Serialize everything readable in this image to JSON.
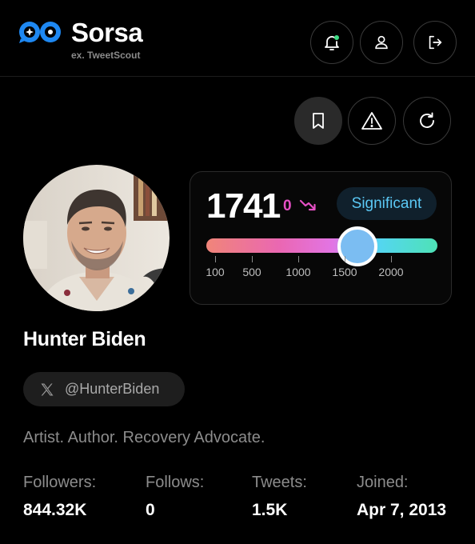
{
  "header": {
    "brand": "Sorsa",
    "brand_sub": "ex. TweetScout",
    "icons": [
      "bell-icon",
      "user-icon",
      "logout-icon"
    ]
  },
  "actions": {
    "icons": [
      "bookmark-icon",
      "warning-icon",
      "refresh-icon"
    ]
  },
  "score": {
    "value": "1741",
    "delta": "0",
    "badge": "Significant",
    "ticks": [
      "100",
      "500",
      "1000",
      "1500",
      "2000"
    ],
    "thumb_value": 1741,
    "range": [
      0,
      2500
    ]
  },
  "profile": {
    "name": "Hunter Biden",
    "handle": "@HunterBiden",
    "bio": "Artist. Author. Recovery Advocate."
  },
  "stats": [
    {
      "label": "Followers:",
      "value": "844.32K"
    },
    {
      "label": "Follows:",
      "value": "0"
    },
    {
      "label": "Tweets:",
      "value": "1.5K"
    },
    {
      "label": "Joined:",
      "value": "Apr 7, 2013"
    }
  ],
  "colors": {
    "accent_pink": "#e54fc4",
    "badge_text": "#5bc8f5",
    "notification_dot": "#3ddc84",
    "logo_blue": "#1e88f2"
  }
}
